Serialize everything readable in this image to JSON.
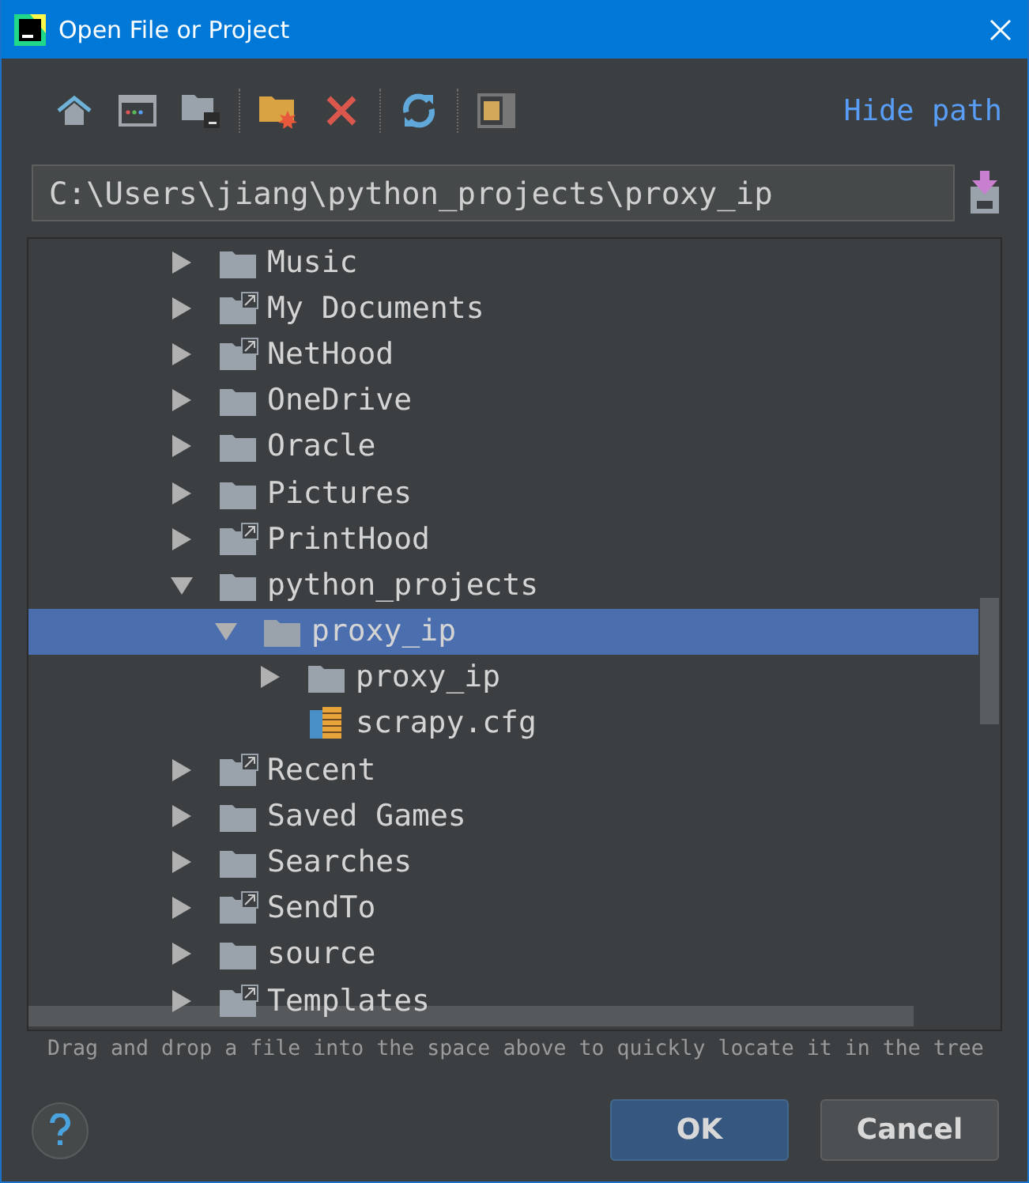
{
  "window": {
    "title": "Open File or Project"
  },
  "toolbar": {
    "hide_path_link": "Hide path"
  },
  "path_field": {
    "value": "C:\\Users\\jiang\\python_projects\\proxy_ip"
  },
  "tree": {
    "items": [
      {
        "label": "Music",
        "kind": "folder",
        "expanded": false,
        "selected": false
      },
      {
        "label": "My Documents",
        "kind": "link",
        "expanded": false,
        "selected": false
      },
      {
        "label": "NetHood",
        "kind": "link",
        "expanded": false,
        "selected": false
      },
      {
        "label": "OneDrive",
        "kind": "folder",
        "expanded": false,
        "selected": false
      },
      {
        "label": "Oracle",
        "kind": "folder",
        "expanded": false,
        "selected": false
      },
      {
        "label": "Pictures",
        "kind": "folder",
        "expanded": false,
        "selected": false
      },
      {
        "label": "PrintHood",
        "kind": "link",
        "expanded": false,
        "selected": false
      },
      {
        "label": "python_projects",
        "kind": "folder",
        "expanded": true,
        "selected": false,
        "children": [
          {
            "label": "proxy_ip",
            "kind": "folder",
            "expanded": true,
            "selected": true,
            "children": [
              {
                "label": "proxy_ip",
                "kind": "folder",
                "expanded": false,
                "selected": false
              },
              {
                "label": "scrapy.cfg",
                "kind": "file",
                "selected": false
              }
            ]
          }
        ]
      },
      {
        "label": "Recent",
        "kind": "link",
        "expanded": false,
        "selected": false
      },
      {
        "label": "Saved Games",
        "kind": "folder",
        "expanded": false,
        "selected": false
      },
      {
        "label": "Searches",
        "kind": "folder",
        "expanded": false,
        "selected": false
      },
      {
        "label": "SendTo",
        "kind": "link",
        "expanded": false,
        "selected": false
      },
      {
        "label": "source",
        "kind": "folder",
        "expanded": false,
        "selected": false
      },
      {
        "label": "Templates",
        "kind": "link",
        "expanded": false,
        "selected": false
      }
    ]
  },
  "hint": "Drag and drop a file into the space above to quickly locate it in the tree",
  "buttons": [
    {
      "label": "OK",
      "kind": "primary"
    },
    {
      "label": "Cancel",
      "kind": "secondary"
    }
  ]
}
